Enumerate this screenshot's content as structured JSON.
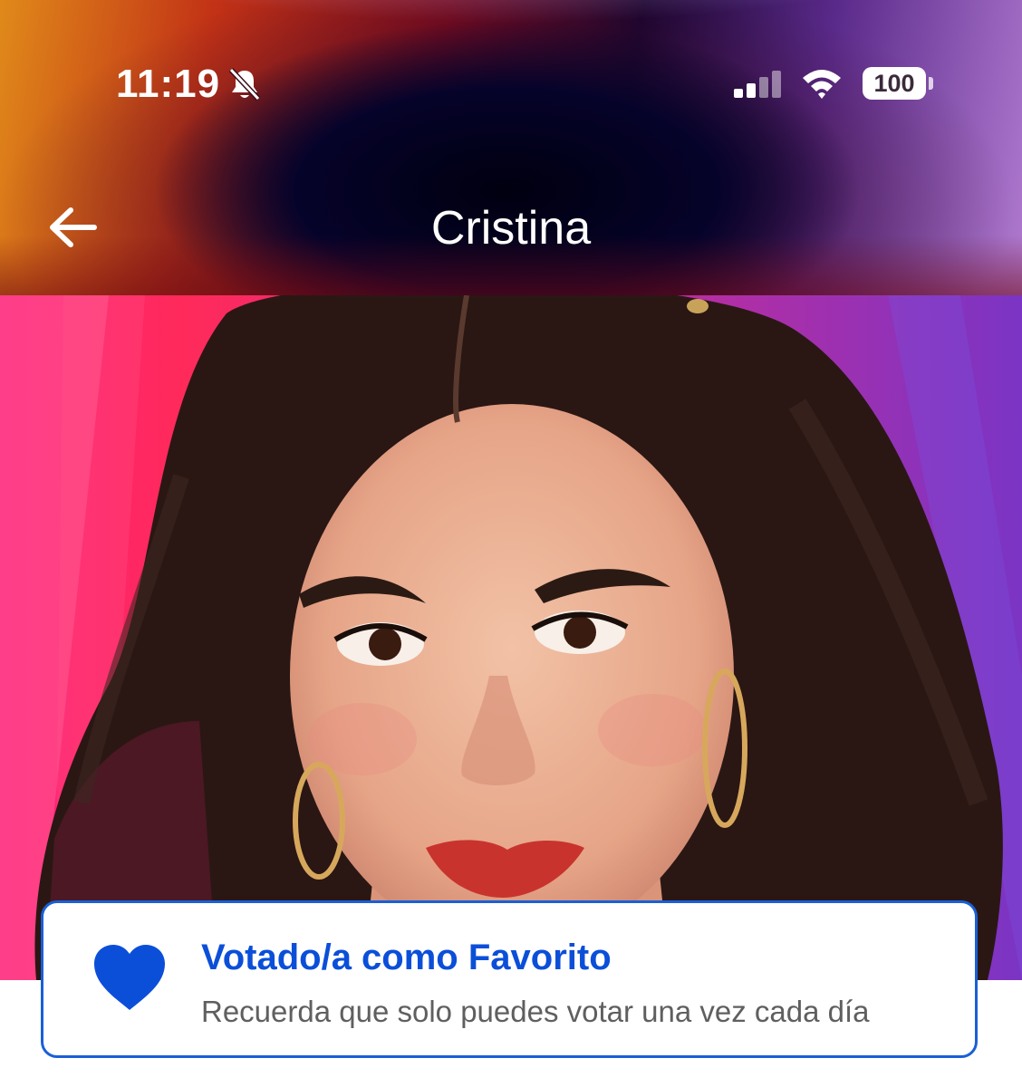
{
  "status_bar": {
    "time": "11:19",
    "battery": "100",
    "icons": [
      "bell-slash-icon",
      "cellular-signal-icon",
      "wifi-icon",
      "battery-icon"
    ]
  },
  "nav": {
    "back_icon": "arrow-left-icon",
    "title": "Cristina"
  },
  "vote_card": {
    "icon": "heart-icon",
    "title": "Votado/a como Favorito",
    "subtitle": "Recuerda que solo puedes votar una vez cada día",
    "accent_color": "#0b4fd9"
  }
}
